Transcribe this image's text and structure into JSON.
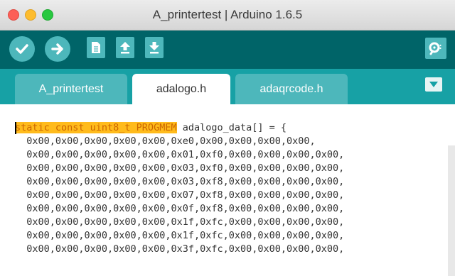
{
  "window": {
    "title": "A_printertest | Arduino 1.6.5"
  },
  "toolbar": {
    "buttons": [
      {
        "icon": "checkmark-icon",
        "name": "verify"
      },
      {
        "icon": "arrow-right-icon",
        "name": "upload"
      },
      {
        "icon": "new-file-icon",
        "name": "new"
      },
      {
        "icon": "arrow-up-icon",
        "name": "open"
      },
      {
        "icon": "arrow-down-icon",
        "name": "save"
      },
      {
        "icon": "magnifier-icon",
        "name": "serial-monitor"
      }
    ]
  },
  "tabs": [
    {
      "label": "A_printertest",
      "active": false
    },
    {
      "label": "adalogo.h",
      "active": true
    },
    {
      "label": "adaqrcode.h",
      "active": false
    }
  ],
  "editor": {
    "keyword": "static const uint8_t PROGMEM",
    "declaration_rest": " adalogo_data[] = {",
    "lines": [
      "  0x00,0x00,0x00,0x00,0x00,0xe0,0x00,0x00,0x00,0x00,",
      "  0x00,0x00,0x00,0x00,0x00,0x01,0xf0,0x00,0x00,0x00,0x00,",
      "  0x00,0x00,0x00,0x00,0x00,0x03,0xf0,0x00,0x00,0x00,0x00,",
      "  0x00,0x00,0x00,0x00,0x00,0x03,0xf8,0x00,0x00,0x00,0x00,",
      "  0x00,0x00,0x00,0x00,0x00,0x07,0xf8,0x00,0x00,0x00,0x00,",
      "  0x00,0x00,0x00,0x00,0x00,0x0f,0xf8,0x00,0x00,0x00,0x00,",
      "  0x00,0x00,0x00,0x00,0x00,0x1f,0xfc,0x00,0x00,0x00,0x00,",
      "  0x00,0x00,0x00,0x00,0x00,0x1f,0xfc,0x00,0x00,0x00,0x00,",
      "  0x00,0x00,0x00,0x00,0x00,0x3f,0xfc,0x00,0x00,0x00,0x00,"
    ]
  },
  "colors": {
    "toolbar": "#006468",
    "tabbar": "#17a1a5",
    "button": "#4db7bb",
    "keyword_highlight": "#ffbb1c",
    "keyword_text": "#cc6600"
  }
}
